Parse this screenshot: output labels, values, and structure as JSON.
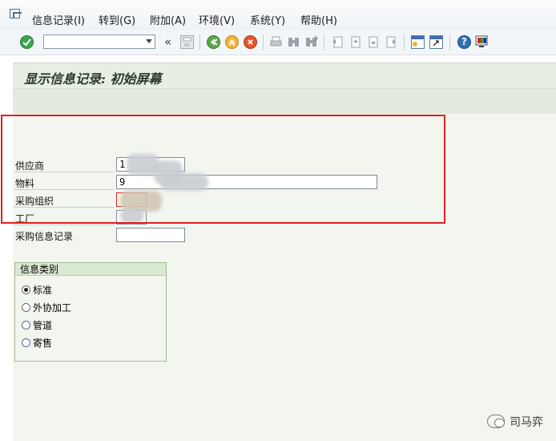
{
  "menu": {
    "items": [
      "信息记录(I)",
      "转到(G)",
      "附加(A)",
      "环境(V)",
      "系统(Y)",
      "帮助(H)"
    ]
  },
  "toolbar": {
    "command_value": "",
    "chevron": "«",
    "icons": [
      "check-icon",
      "save-icon",
      "back-icon",
      "exit-icon",
      "cancel-icon",
      "print-icon",
      "find-icon",
      "find-next-icon",
      "first-page-icon",
      "prev-page-icon",
      "next-page-icon",
      "last-page-icon",
      "new-session-icon",
      "shortcut-icon",
      "help-icon",
      "layout-icon"
    ]
  },
  "title": "显示信息记录: 初始屏幕",
  "form": {
    "vendor_label": "供应商",
    "material_label": "物料",
    "purch_org_label": "采购组织",
    "plant_label": "工厂",
    "info_record_label": "采购信息记录",
    "vendor_value": "1",
    "material_value": "9",
    "purch_org_value": "",
    "plant_value": "",
    "info_record_value": ""
  },
  "info_category": {
    "title": "信息类别",
    "options": [
      "标准",
      "外协加工",
      "管道",
      "寄售"
    ],
    "selected": "标准"
  },
  "watermark": "司马弈",
  "colors": {
    "highlight": "#e02020",
    "title_bg": "#e7efe3",
    "content_bg": "#f2f6ef"
  }
}
